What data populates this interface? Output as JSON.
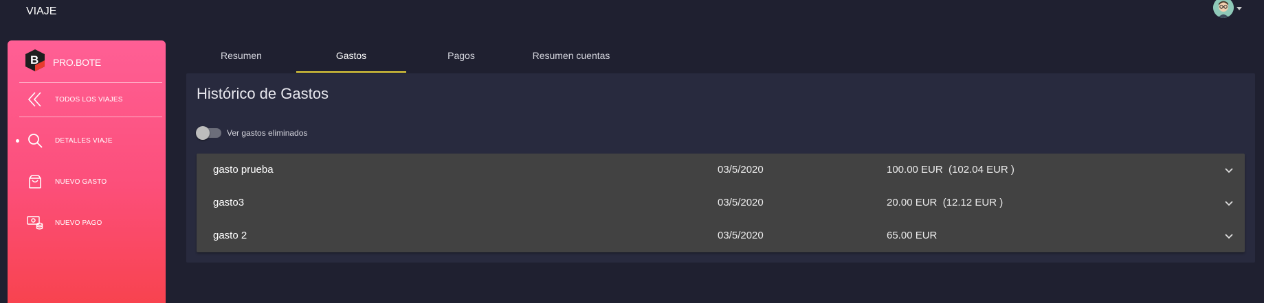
{
  "app": {
    "title": "VIAJE"
  },
  "sidebar": {
    "brand": "PRO.BOTE",
    "items": [
      {
        "label": "TODOS LOS VIAJES",
        "icon": "double-chevron-left-icon"
      },
      {
        "label": "DETALLES VIAJE",
        "icon": "search-icon",
        "active": true
      },
      {
        "label": "NUEVO GASTO",
        "icon": "shopping-bag-icon"
      },
      {
        "label": "NUEVO PAGO",
        "icon": "money-icon"
      }
    ]
  },
  "tabs": [
    {
      "label": "Resumen"
    },
    {
      "label": "Gastos",
      "active": true
    },
    {
      "label": "Pagos"
    },
    {
      "label": "Resumen cuentas"
    }
  ],
  "main": {
    "title": "Histórico de Gastos",
    "toggle_label": "Ver gastos eliminados",
    "toggle_on": false,
    "expenses": [
      {
        "name": "gasto prueba",
        "date": "03/5/2020",
        "amount": "100.00 EUR  (102.04 EUR )"
      },
      {
        "name": "gasto3",
        "date": "03/5/2020",
        "amount": "20.00 EUR  (12.12 EUR )"
      },
      {
        "name": "gasto 2",
        "date": "03/5/2020",
        "amount": "65.00 EUR"
      }
    ]
  },
  "colors": {
    "background": "#1f2030",
    "card": "#282a3e",
    "list": "#424242",
    "accent_tab": "#e8d33a",
    "sidebar_top": "#ff5f95",
    "sidebar_bottom": "#f8434f"
  }
}
